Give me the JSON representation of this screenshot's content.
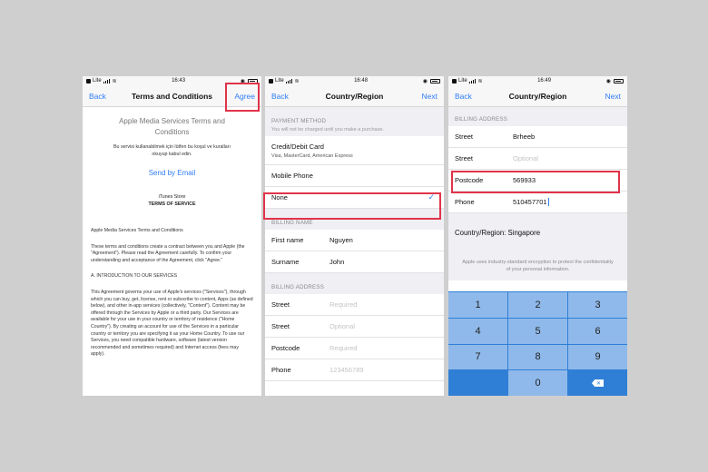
{
  "status": {
    "p1": {
      "carrier": "Lite",
      "time": "16:43"
    },
    "p2": {
      "carrier": "Lite",
      "time": "16:48"
    },
    "p3": {
      "carrier": "Lite",
      "time": "16:49"
    }
  },
  "panel1": {
    "nav": {
      "back": "Back",
      "title": "Terms and Conditions",
      "agree": "Agree"
    },
    "heading": "Apple Media Services Terms and Conditions",
    "turkish": "Bu servisi kullanabilmek için lütfen bu koşul ve kuralları okuyup kabul edin.",
    "send_email": "Send by Email",
    "store_line1": "iTunes Store",
    "store_line2": "TERMS OF SERVICE",
    "para1": "Apple Media Services Terms and Conditions",
    "para2": "These terms and conditions create a contract between you and Apple (the \"Agreement\"). Please read the Agreement carefully. To confirm your understanding and acceptance of the Agreement, click \"Agree.\"",
    "para3": "A. INTRODUCTION TO OUR SERVICES",
    "para4": "This Agreement governs your use of Apple's services (\"Services\"), through which you can buy, get, license, rent or subscribe to content, Apps (as defined below), and other in-app services (collectively, \"Content\"). Content may be offered through the Services by Apple or a third party. Our Services are available for your use in your country or territory of residence (\"Home Country\"). By creating an account for use of the Services in a particular country or territory you are specifying it as your Home Country. To use our Services, you need compatible hardware, software (latest version recommended and sometimes required) and Internet access (fees may apply)."
  },
  "panel2": {
    "nav": {
      "back": "Back",
      "title": "Country/Region",
      "next": "Next"
    },
    "payment_header": "PAYMENT METHOD",
    "payment_sub": "You will not be charged until you make a purchase.",
    "credit": "Credit/Debit Card",
    "credit_sub": "Visa, MasterCard, American Express",
    "mobile": "Mobile Phone",
    "none": "None",
    "billing_name_header": "BILLING NAME",
    "first_name_label": "First name",
    "first_name_value": "Nguyen",
    "surname_label": "Surname",
    "surname_value": "John",
    "billing_address_header": "BILLING ADDRESS",
    "street_label": "Street",
    "street_ph": "Required",
    "street2_label": "Street",
    "street2_ph": "Optional",
    "postcode_label": "Postcode",
    "postcode_ph": "Required",
    "phone_label": "Phone",
    "phone_ph": "123456789"
  },
  "panel3": {
    "nav": {
      "back": "Back",
      "title": "Country/Region",
      "next": "Next"
    },
    "billing_address_header": "BILLING ADDRESS",
    "street_label": "Street",
    "street_value": "Brheeb",
    "street2_label": "Street",
    "street2_ph": "Optional",
    "postcode_label": "Postcode",
    "postcode_value": "569933",
    "phone_label": "Phone",
    "phone_value": "510457701",
    "country": "Country/Region: Singapore",
    "note": "Apple uses industry-standard encryption to protect the confidentiality of your personal information.",
    "keys": [
      "1",
      "2",
      "3",
      "4",
      "5",
      "6",
      "7",
      "8",
      "9",
      "",
      "0",
      "✕"
    ]
  },
  "colors": {
    "accent": "#2f7df6",
    "highlight": "#e0344a",
    "keypad": "#2f7fd6"
  }
}
